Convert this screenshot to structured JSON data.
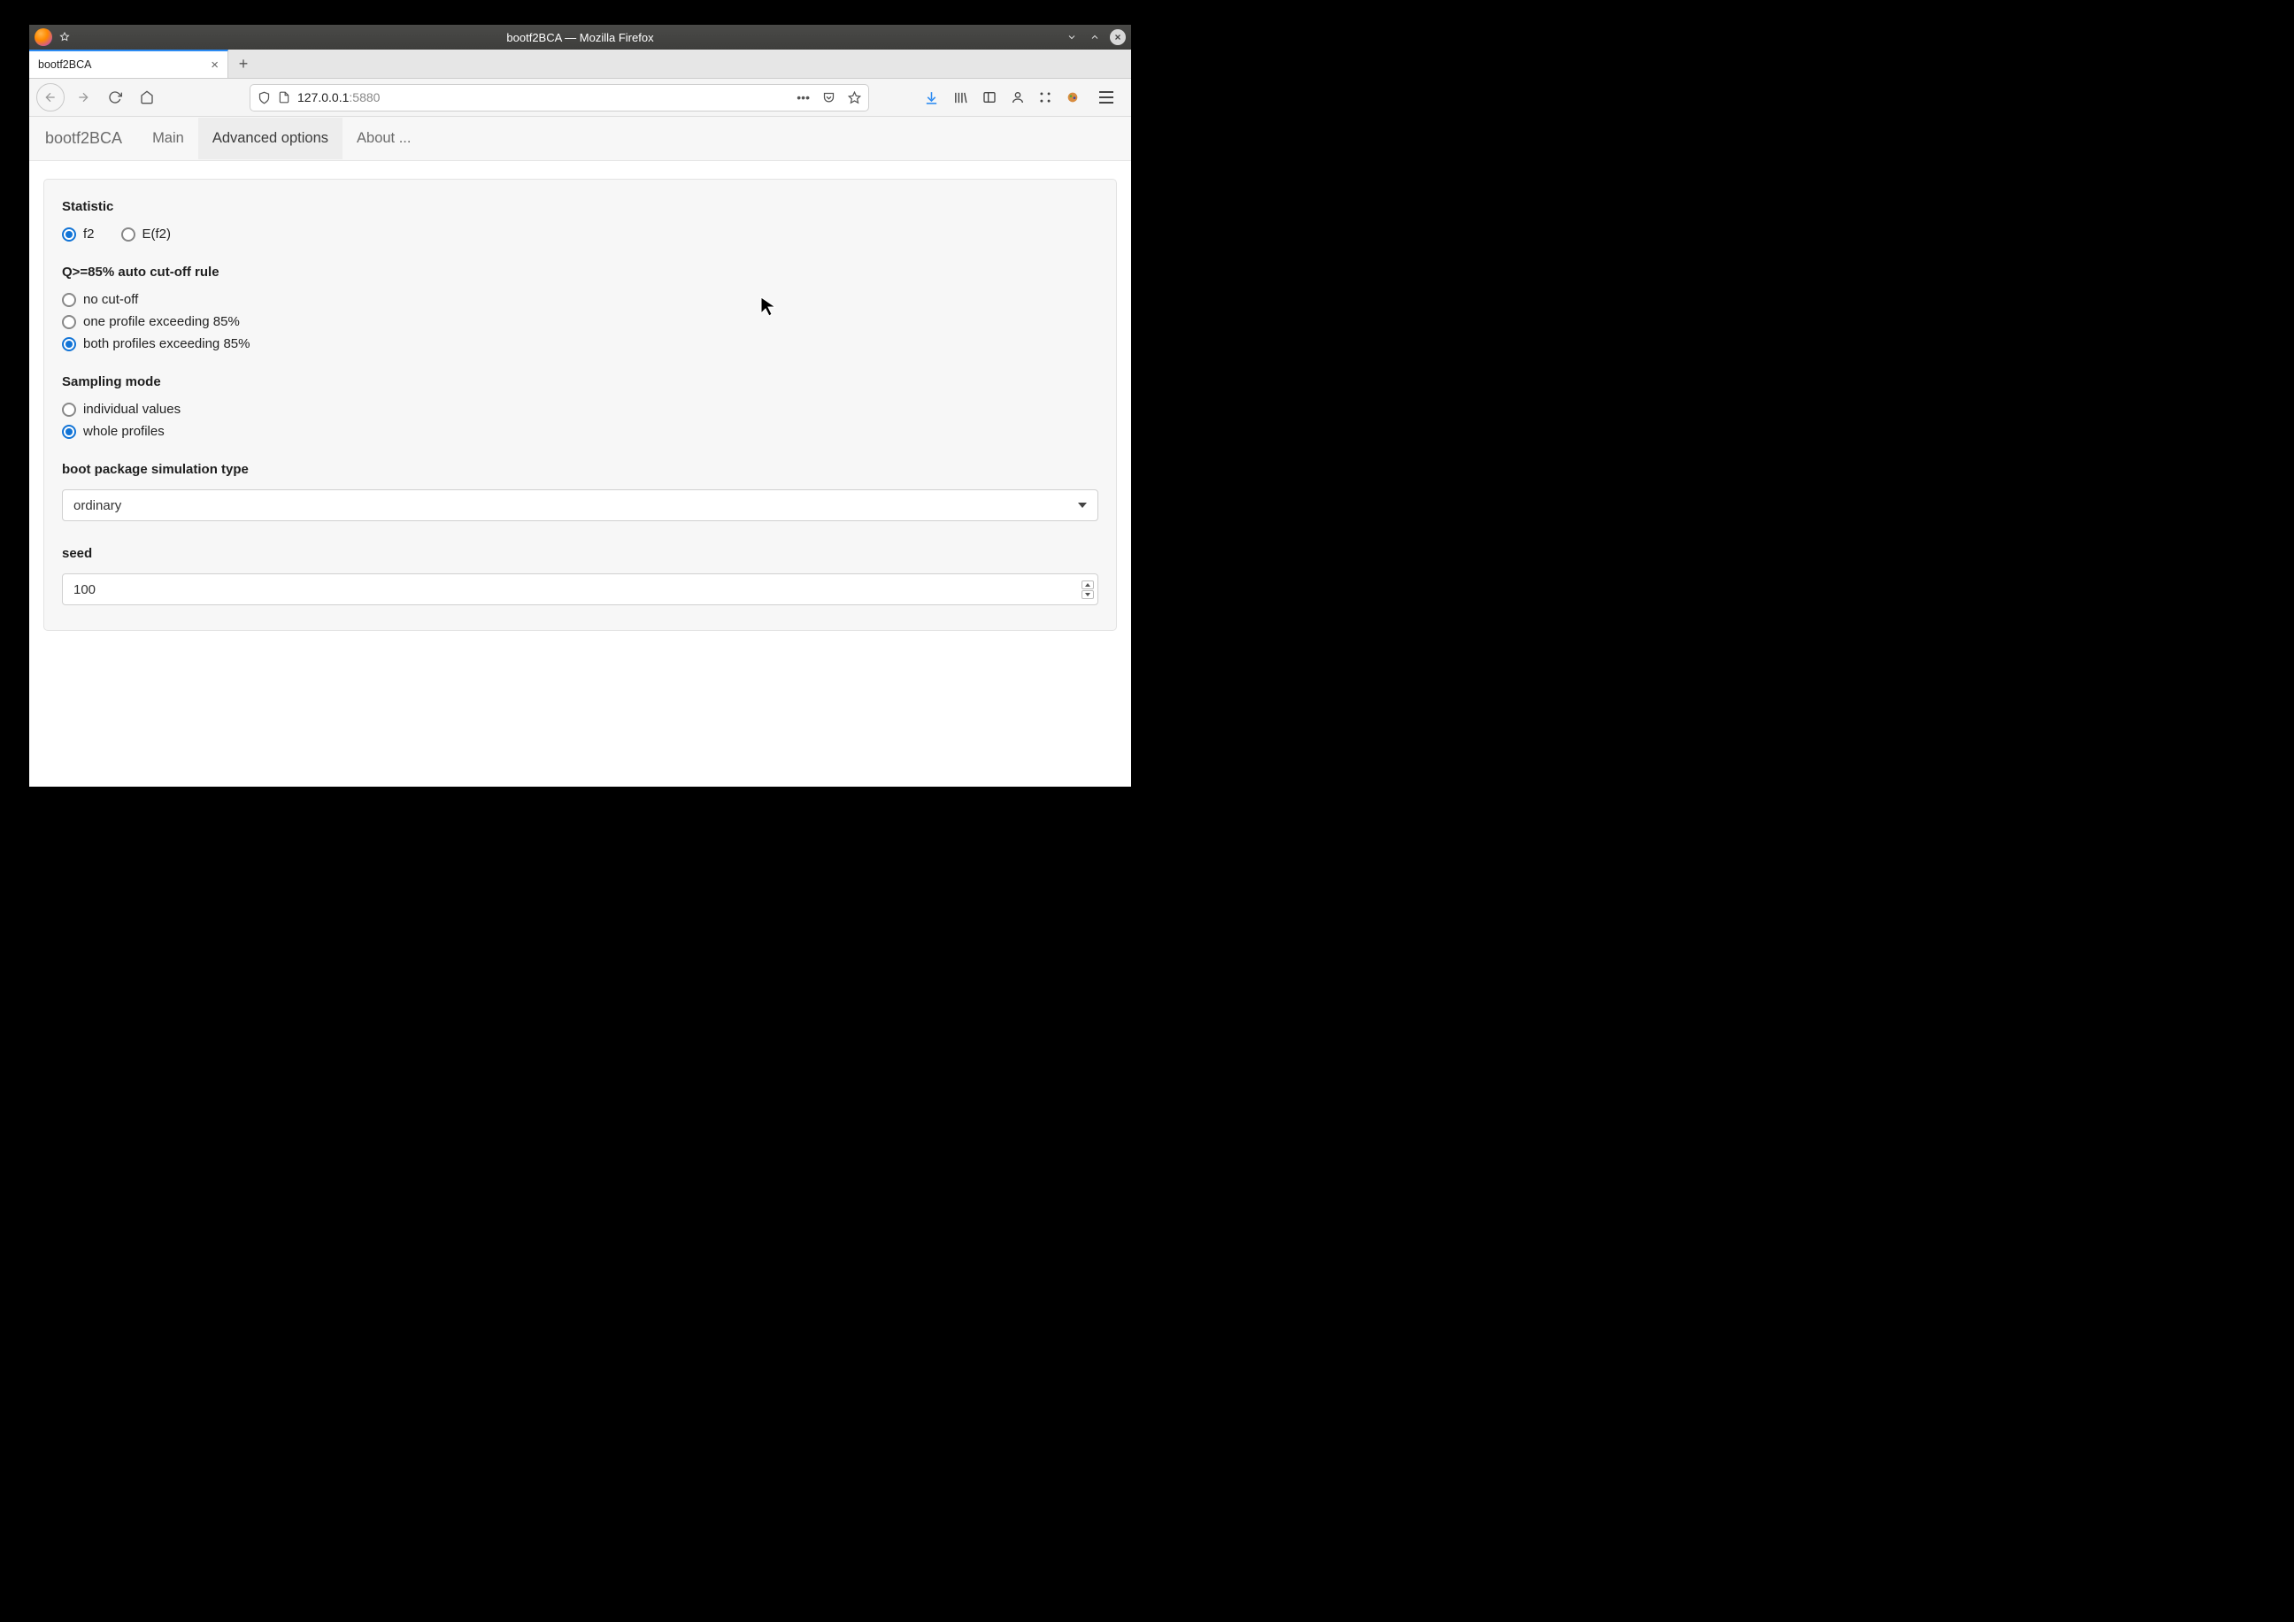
{
  "window": {
    "title": "bootf2BCA — Mozilla Firefox"
  },
  "tab": {
    "label": "bootf2BCA"
  },
  "url": {
    "host": "127.0.0.1",
    "port": ":5880"
  },
  "appnav": {
    "brand": "bootf2BCA",
    "tabs": {
      "main": "Main",
      "advanced": "Advanced options",
      "about": "About ..."
    },
    "active": "advanced"
  },
  "form": {
    "statistic": {
      "label": "Statistic",
      "options": {
        "f2": "f2",
        "ef2": "E(f2)"
      },
      "selected": "f2"
    },
    "cutoff": {
      "label": "Q>=85% auto cut-off rule",
      "options": {
        "none": "no cut-off",
        "one": "one profile exceeding 85%",
        "both": "both profiles exceeding 85%"
      },
      "selected": "both"
    },
    "sampling": {
      "label": "Sampling mode",
      "options": {
        "individual": "individual values",
        "whole": "whole profiles"
      },
      "selected": "whole"
    },
    "simtype": {
      "label": "boot package simulation type",
      "value": "ordinary"
    },
    "seed": {
      "label": "seed",
      "value": "100"
    }
  }
}
